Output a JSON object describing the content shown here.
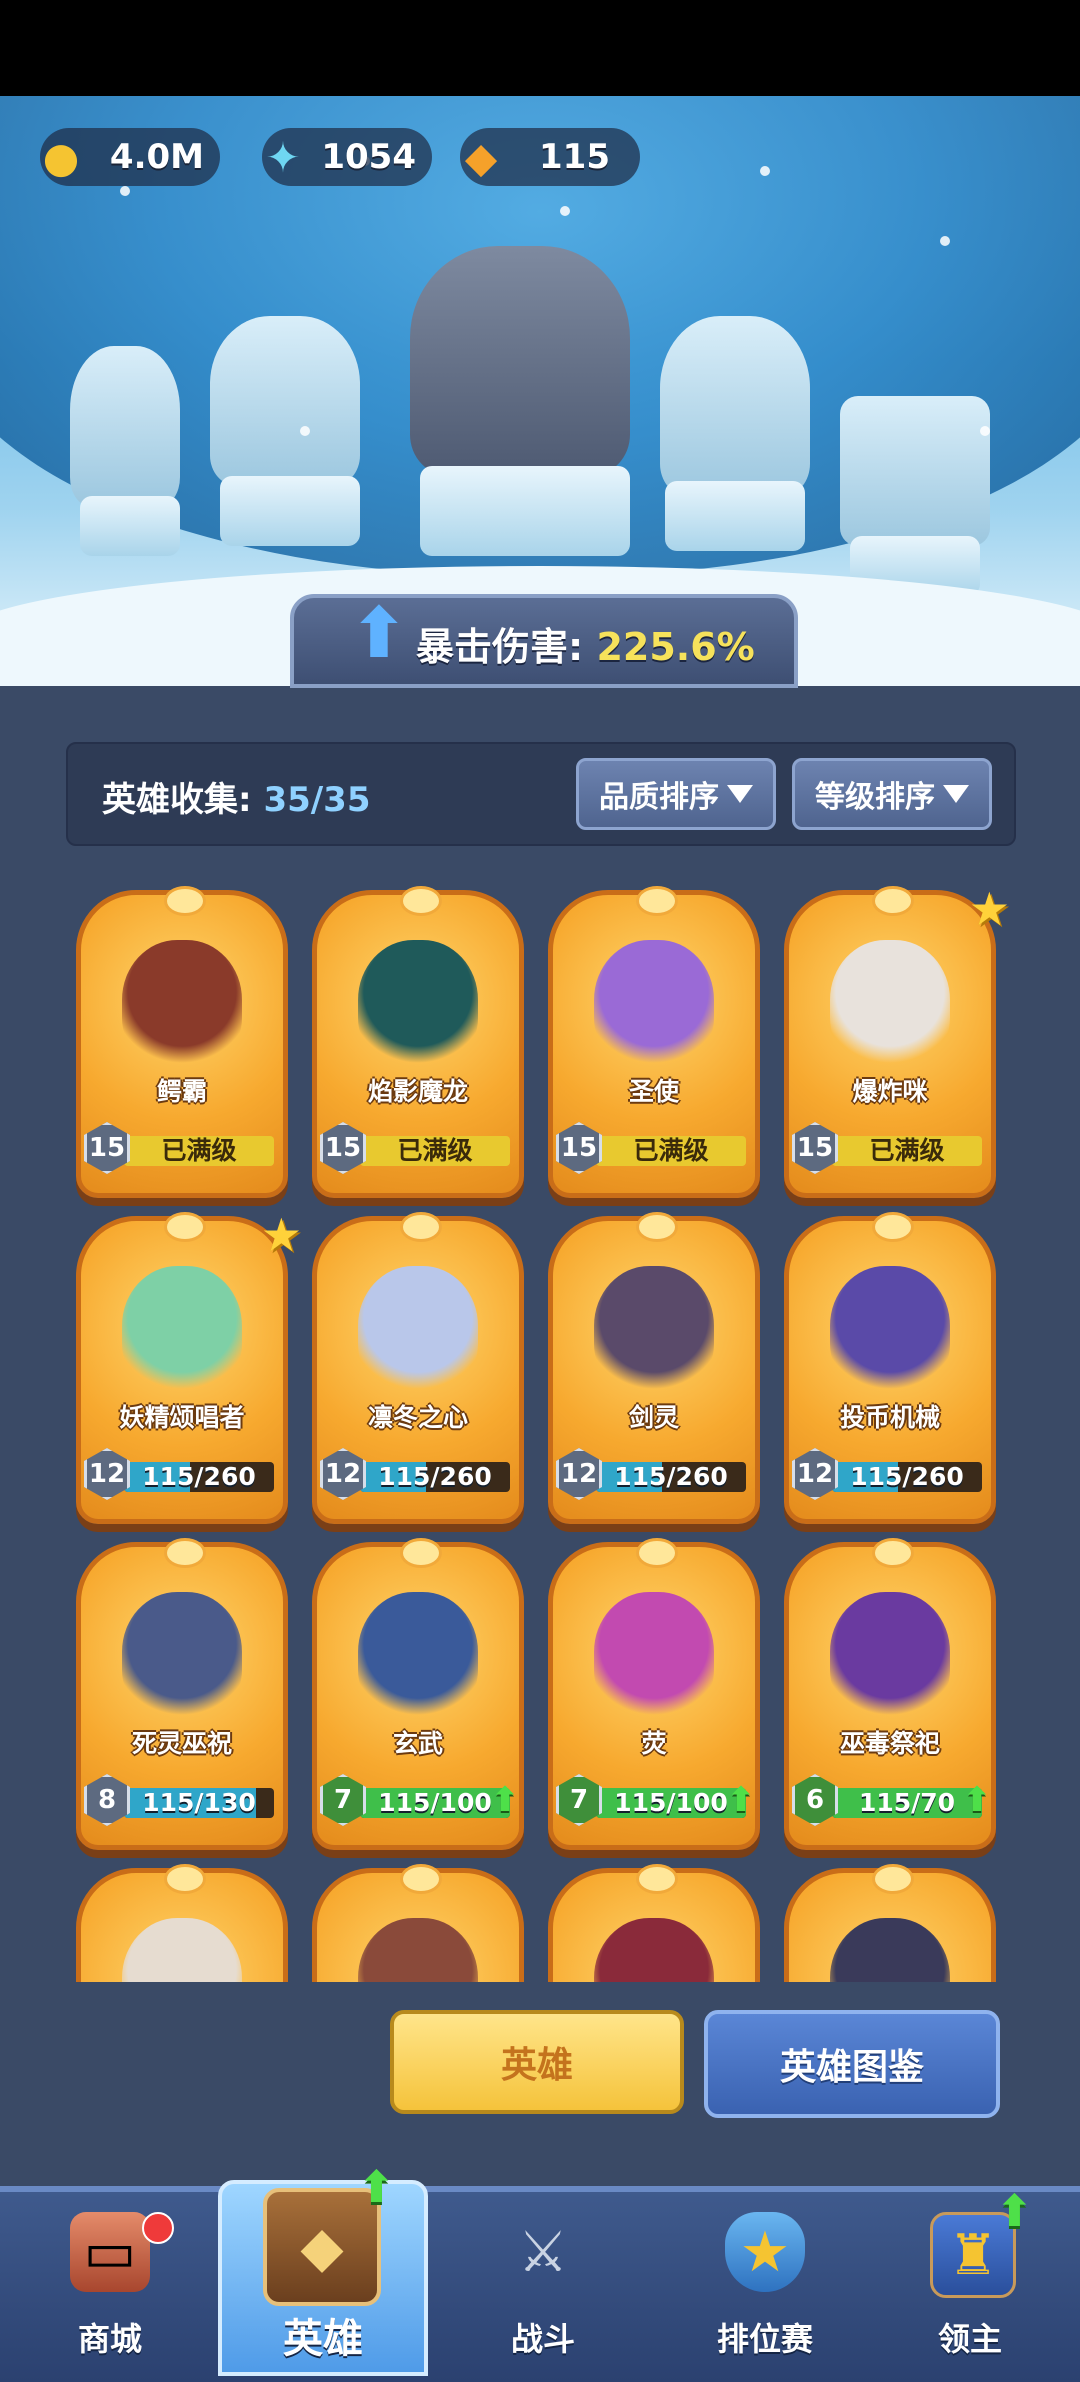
{
  "resources": {
    "gold": {
      "icon": "gold-coin-icon",
      "value": "4.0M"
    },
    "gem": {
      "icon": "blue-crystal-icon",
      "value": "1054"
    },
    "energy": {
      "icon": "orange-crystal-icon",
      "value": "115"
    }
  },
  "crit": {
    "label": "暴击伤害:",
    "value": "225.6%"
  },
  "collection": {
    "label": "英雄收集:",
    "value": "35/35"
  },
  "sort": {
    "quality": "品质排序",
    "level": "等级排序"
  },
  "heroes": [
    {
      "name": "鳄霸",
      "level": "15",
      "progress": "已满级",
      "fill": 1.0,
      "full": true,
      "star": false,
      "upgrade": false,
      "art": "#8a3a2a"
    },
    {
      "name": "焰影魔龙",
      "level": "15",
      "progress": "已满级",
      "fill": 1.0,
      "full": true,
      "star": false,
      "upgrade": false,
      "art": "#1f5a5a"
    },
    {
      "name": "圣使",
      "level": "15",
      "progress": "已满级",
      "fill": 1.0,
      "full": true,
      "star": false,
      "upgrade": false,
      "art": "#9a6ad6"
    },
    {
      "name": "爆炸咪",
      "level": "15",
      "progress": "已满级",
      "fill": 1.0,
      "full": true,
      "star": true,
      "upgrade": false,
      "art": "#e8e2dc"
    },
    {
      "name": "妖精颂唱者",
      "level": "12",
      "progress": "115/260",
      "fill": 0.44,
      "full": false,
      "star": true,
      "upgrade": false,
      "art": "#7ed0a6"
    },
    {
      "name": "凛冬之心",
      "level": "12",
      "progress": "115/260",
      "fill": 0.44,
      "full": false,
      "star": false,
      "upgrade": false,
      "art": "#b9c7ea"
    },
    {
      "name": "剑灵",
      "level": "12",
      "progress": "115/260",
      "fill": 0.44,
      "full": false,
      "star": false,
      "upgrade": false,
      "art": "#5a4a6a"
    },
    {
      "name": "投币机械",
      "level": "12",
      "progress": "115/260",
      "fill": 0.44,
      "full": false,
      "star": false,
      "upgrade": false,
      "art": "#5a4aa8"
    },
    {
      "name": "死灵巫祝",
      "level": "8",
      "progress": "115/130",
      "fill": 0.88,
      "full": false,
      "star": false,
      "upgrade": false,
      "art": "#4a5a8a"
    },
    {
      "name": "玄武",
      "level": "7",
      "progress": "115/100",
      "fill": 1.0,
      "full": false,
      "star": false,
      "upgrade": true,
      "art": "#3a5a9a"
    },
    {
      "name": "荧",
      "level": "7",
      "progress": "115/100",
      "fill": 1.0,
      "full": false,
      "star": false,
      "upgrade": true,
      "art": "#c24ab0"
    },
    {
      "name": "巫毒祭祀",
      "level": "6",
      "progress": "115/70",
      "fill": 1.0,
      "full": false,
      "star": false,
      "upgrade": true,
      "art": "#6a3aa0"
    },
    {
      "name": "",
      "level": "",
      "progress": "",
      "fill": 0,
      "full": false,
      "star": false,
      "upgrade": false,
      "art": "#e6dcd0"
    },
    {
      "name": "",
      "level": "",
      "progress": "",
      "fill": 0,
      "full": false,
      "star": false,
      "upgrade": false,
      "art": "#8a4a3a"
    },
    {
      "name": "",
      "level": "",
      "progress": "",
      "fill": 0,
      "full": false,
      "star": false,
      "upgrade": false,
      "art": "#8a2a3a"
    },
    {
      "name": "",
      "level": "",
      "progress": "",
      "fill": 0,
      "full": false,
      "star": false,
      "upgrade": false,
      "art": "#3a3a5a"
    }
  ],
  "buttons": {
    "hero": "英雄",
    "codex": "英雄图鉴"
  },
  "nav": [
    {
      "label": "商城",
      "icon": "shop-chest-icon",
      "badge": "red-dot"
    },
    {
      "label": "英雄",
      "icon": "hero-card-icon",
      "badge": "upgrade-arrow"
    },
    {
      "label": "战斗",
      "icon": "crossed-swords-icon",
      "badge": ""
    },
    {
      "label": "排位赛",
      "icon": "rank-shield-icon",
      "badge": ""
    },
    {
      "label": "领主",
      "icon": "castle-banner-icon",
      "badge": "upgrade-arrow"
    }
  ]
}
